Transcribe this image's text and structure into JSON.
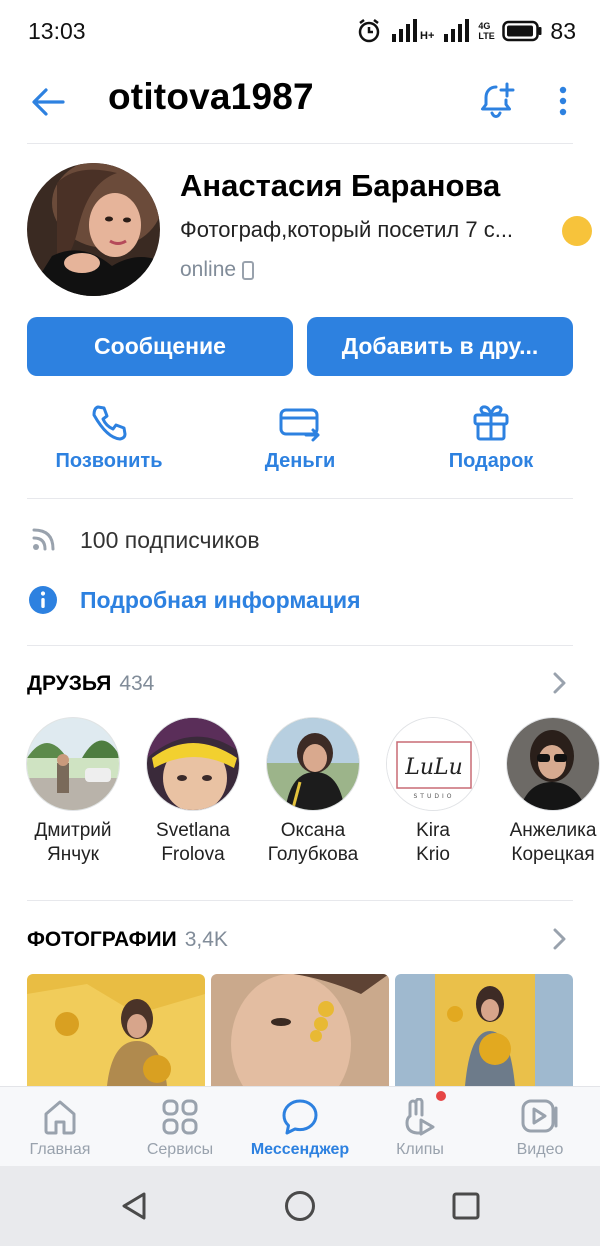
{
  "status_bar": {
    "time": "13:03",
    "network": "H+",
    "network_type": "4G LTE",
    "battery": "83"
  },
  "header": {
    "title": "otitova1987"
  },
  "profile": {
    "name": "Анастасия Баранова",
    "status": "Фотограф,который посетил 7 с...",
    "online": "online"
  },
  "buttons": {
    "message": "Сообщение",
    "add_friend": "Добавить в дру..."
  },
  "actions": [
    {
      "label": "Позвонить",
      "icon": "phone-icon"
    },
    {
      "label": "Деньги",
      "icon": "money-transfer-icon"
    },
    {
      "label": "Подарок",
      "icon": "gift-icon"
    }
  ],
  "info": {
    "followers": "100 подписчиков",
    "details": "Подробная информация"
  },
  "friends": {
    "title": "ДРУЗЬЯ",
    "count": "434",
    "items": [
      {
        "first": "Дмитрий",
        "last": "Янчук"
      },
      {
        "first": "Svetlana",
        "last": "Frolova"
      },
      {
        "first": "Оксана",
        "last": "Голубкова"
      },
      {
        "first": "Kira",
        "last": "Krio"
      },
      {
        "first": "Анжелика",
        "last": "Корецкая"
      }
    ],
    "kira_logo_text": "LuLu",
    "kira_logo_sub": "STUDIO"
  },
  "photos": {
    "title": "ФОТОГРАФИИ",
    "count": "3,4K"
  },
  "tabs": [
    {
      "label": "Главная",
      "icon": "home-icon"
    },
    {
      "label": "Сервисы",
      "icon": "services-grid-icon"
    },
    {
      "label": "Мессенджер",
      "icon": "messenger-icon"
    },
    {
      "label": "Клипы",
      "icon": "clips-icon"
    },
    {
      "label": "Видео",
      "icon": "video-icon"
    }
  ],
  "colors": {
    "accent": "#2d81e0",
    "secondary_text": "#818c99",
    "tab_inactive": "#99a2ad",
    "badge": "#e64646"
  }
}
